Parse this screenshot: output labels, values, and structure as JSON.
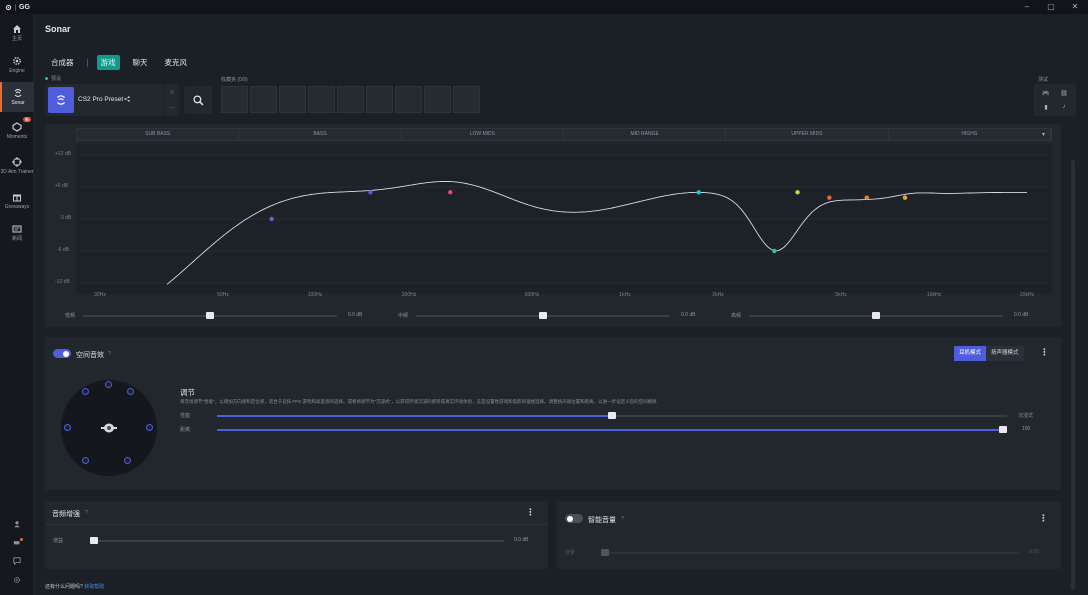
{
  "app": {
    "logo_text": "GG",
    "window_controls": [
      "–",
      "▢",
      "✕"
    ]
  },
  "sidebar": {
    "items": [
      {
        "label": "主页",
        "icon": "home-icon"
      },
      {
        "label": "Engine",
        "icon": "gear-icon"
      },
      {
        "label": "Sonar",
        "icon": "sonar-icon",
        "active": true
      },
      {
        "label": "Moments",
        "icon": "moments-icon",
        "badge": "新"
      },
      {
        "label": "3D Aim Trainer",
        "icon": "crosshair-icon"
      },
      {
        "label": "Giveaways",
        "icon": "gift-icon"
      },
      {
        "label": "新闻",
        "icon": "news-icon"
      }
    ]
  },
  "page": {
    "title": "Sonar"
  },
  "tabs": [
    {
      "label": "合成器",
      "active": false
    },
    {
      "label": "游戏",
      "active": true
    },
    {
      "label": "聊天",
      "active": false
    },
    {
      "label": "麦克风",
      "active": false
    }
  ],
  "preset": {
    "section_label": "预设",
    "name": "CS2 Pro Preset",
    "favorites_label": "收藏夹 (0/9)",
    "test_label": "测试"
  },
  "eq": {
    "bands": [
      "SUB BASS",
      "BASS",
      "LOW MIDS",
      "MID RANGE",
      "UPPER MIDS",
      "HIGHS"
    ],
    "db_labels": [
      "+12 dB",
      "+6 dB",
      "0 dB",
      "-6 dB",
      "-12 dB"
    ],
    "freq_labels": [
      "30Hz",
      "50Hz",
      "100Hz",
      "200Hz",
      "500Hz",
      "1kHz",
      "2kHz",
      "5kHz",
      "10kHz",
      "20kHz"
    ],
    "nodes": [
      {
        "freq": 100,
        "gain": 0,
        "color": "#8a4fe0"
      },
      {
        "freq": 200,
        "gain": 5,
        "color": "#4d5ddb"
      },
      {
        "freq": 350,
        "gain": 5,
        "color": "#e8467a"
      },
      {
        "freq": 2000,
        "gain": 5,
        "color": "#19c3d6"
      },
      {
        "freq": 3400,
        "gain": -6,
        "color": "#1fd08b"
      },
      {
        "freq": 4000,
        "gain": 5,
        "color": "#b5e23c"
      },
      {
        "freq": 5000,
        "gain": 4,
        "color": "#f0603a"
      },
      {
        "freq": 6500,
        "gain": 4,
        "color": "#f07a3a"
      },
      {
        "freq": 8500,
        "gain": 4,
        "color": "#f0a03a"
      }
    ],
    "controls": [
      {
        "label": "低频",
        "value": "0.0 dB",
        "level": 0.5
      },
      {
        "label": "中频",
        "value": "0.0 dB",
        "level": 0.5
      },
      {
        "label": "高频",
        "value": "0.0 dB",
        "level": 0.5
      }
    ]
  },
  "spatial": {
    "title": "空间音效",
    "help": "?",
    "modes": [
      "耳机模式",
      "扬声器模式"
    ],
    "adjust_title": "调节",
    "adjust_desc": "将音场调节\"性能\"，以增加方向感和定位感，适合于竞技 FPS 游戏和高度感的选择。或者将调节为\"沉浸式\"，以获得环境沉浸的感受或真实环境体验，这是设置性游戏和电影的理想选择。调整扬声器位置和距离，以进一步设定义您的空间模拟",
    "slider1": {
      "label": "性能",
      "value": "沉浸式",
      "level": 0.5
    },
    "slider2": {
      "label": "距离",
      "value": "100",
      "level": 1.0
    }
  },
  "bass": {
    "title": "音频增强",
    "help": "?",
    "label": "增益",
    "value": "0.0 dB",
    "level": 0
  },
  "smart": {
    "title": "智能音量",
    "help": "?",
    "label": "音量",
    "value": "0.00",
    "level": 0
  },
  "footer": {
    "text": "还有什么问题吗?",
    "link": "获取帮助"
  }
}
